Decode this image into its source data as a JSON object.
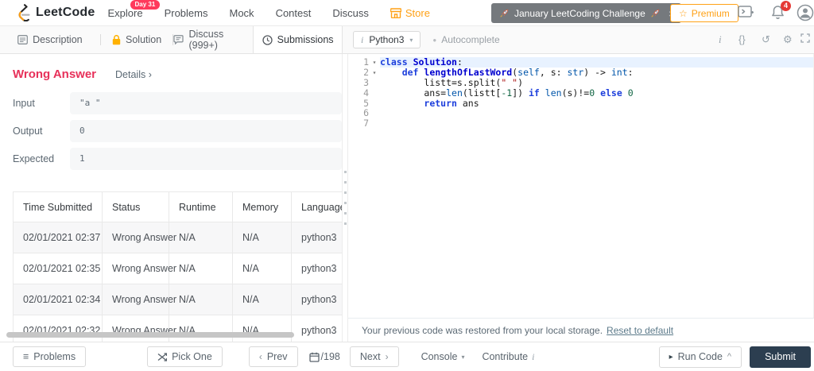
{
  "nav": {
    "brand": "LeetCode",
    "items": [
      {
        "label": "Explore",
        "badge": "Day 31"
      },
      {
        "label": "Problems"
      },
      {
        "label": "Mock"
      },
      {
        "label": "Contest"
      },
      {
        "label": "Discuss"
      },
      {
        "label": "Store"
      }
    ],
    "banner": {
      "text": "January LeetCoding Challenge",
      "close": "×"
    },
    "premium_label": "Premium",
    "premium_star": "☆",
    "notification_count": "4"
  },
  "tabs": [
    {
      "label": "Description"
    },
    {
      "label": "Solution"
    },
    {
      "label": "Discuss (999+)"
    },
    {
      "label": "Submissions"
    }
  ],
  "editor_toolbar": {
    "language": "Python3",
    "info_glyph": "i",
    "autocomplete_label": "Autocomplete",
    "dot": "●",
    "caret": "▾",
    "icons": {
      "info": "i",
      "braces": "{}",
      "reset": "↺",
      "gear": "⚙"
    }
  },
  "result": {
    "title": "Wrong Answer",
    "details_label": "Details ›",
    "fields": [
      {
        "label": "Input",
        "value": "\"a \""
      },
      {
        "label": "Output",
        "value": "0"
      },
      {
        "label": "Expected",
        "value": "1"
      }
    ]
  },
  "submissions_table": {
    "headers": [
      "Time Submitted",
      "Status",
      "Runtime",
      "Memory",
      "Language"
    ],
    "rows": [
      [
        "02/01/2021 02:37",
        "Wrong Answer",
        "N/A",
        "N/A",
        "python3"
      ],
      [
        "02/01/2021 02:35",
        "Wrong Answer",
        "N/A",
        "N/A",
        "python3"
      ],
      [
        "02/01/2021 02:34",
        "Wrong Answer",
        "N/A",
        "N/A",
        "python3"
      ],
      [
        "02/01/2021 02:32",
        "Wrong Answer",
        "N/A",
        "N/A",
        "python3"
      ]
    ]
  },
  "code": {
    "lines": [
      {
        "num": 1,
        "fold": true,
        "highlight": true,
        "tokens": [
          [
            "k",
            "class"
          ],
          [
            "p",
            " "
          ],
          [
            "d",
            "Solution"
          ],
          [
            "p",
            ":"
          ]
        ]
      },
      {
        "num": 2,
        "fold": true,
        "tokens": [
          [
            "p",
            "    "
          ],
          [
            "k",
            "def"
          ],
          [
            "p",
            " "
          ],
          [
            "d",
            "lengthOfLastWord"
          ],
          [
            "p",
            "("
          ],
          [
            "v2",
            "self"
          ],
          [
            "p",
            ", s: "
          ],
          [
            "b",
            "str"
          ],
          [
            "p",
            ") -> "
          ],
          [
            "b",
            "int"
          ],
          [
            "p",
            ":"
          ]
        ]
      },
      {
        "num": 3,
        "tokens": [
          [
            "p",
            "        listt=s.split("
          ],
          [
            "s",
            "\" \""
          ],
          [
            "p",
            ")"
          ]
        ]
      },
      {
        "num": 4,
        "tokens": [
          [
            "p",
            "        ans="
          ],
          [
            "b",
            "len"
          ],
          [
            "p",
            "(listt["
          ],
          [
            "n",
            "-1"
          ],
          [
            "p",
            "]) "
          ],
          [
            "k",
            "if"
          ],
          [
            "p",
            " "
          ],
          [
            "b",
            "len"
          ],
          [
            "p",
            "(s)!="
          ],
          [
            "n",
            "0"
          ],
          [
            "p",
            " "
          ],
          [
            "k",
            "else"
          ],
          [
            "p",
            " "
          ],
          [
            "n",
            "0"
          ]
        ]
      },
      {
        "num": 5,
        "tokens": [
          [
            "p",
            "        "
          ],
          [
            "k",
            "return"
          ],
          [
            "p",
            " ans"
          ]
        ]
      },
      {
        "num": 6,
        "tokens": []
      },
      {
        "num": 7,
        "tokens": []
      }
    ]
  },
  "restore_notice": {
    "text": "Your previous code was restored from your local storage.",
    "link": "Reset to default"
  },
  "footer": {
    "problems_label": "Problems",
    "menu_glyph": "≡",
    "pick_one_label": "Pick One",
    "prev_chevron": "‹",
    "prev_label": "Prev",
    "counter": "/198",
    "next_label": "Next",
    "next_chevron": "›",
    "console_label": "Console",
    "contribute_label": "Contribute",
    "contribute_info": "i",
    "run_play": "▸",
    "run_label": "Run Code",
    "run_caret": "^",
    "submit_label": "Submit"
  },
  "colors": {
    "accent_orange": "#ffa116",
    "badge_pink": "#ff3a5c",
    "result_title": "#e7315a",
    "wrong_answer": "#e74c3c",
    "notification_red": "#e53935",
    "submit_bg": "#2c3e50",
    "activeline": "#e8f2ff",
    "lock_orange": "#ffb100"
  }
}
